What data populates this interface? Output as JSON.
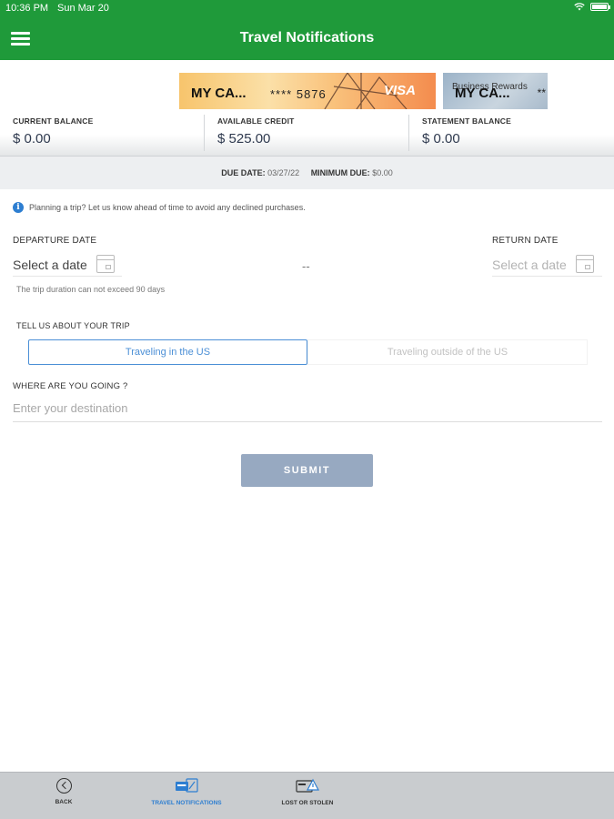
{
  "status_bar": {
    "time": "10:36 PM",
    "date": "Sun Mar 20"
  },
  "header": {
    "title": "Travel Notifications",
    "menu_icon": "hamburger-menu-icon"
  },
  "cards": {
    "primary": {
      "name": "MY CA...",
      "number": "**** 5876",
      "brand": "VISA"
    },
    "secondary": {
      "subtitle": "Business Rewards",
      "name": "MY CA...",
      "number_suffix": "**"
    }
  },
  "balances": {
    "current": {
      "label": "CURRENT BALANCE",
      "value": "$ 0.00"
    },
    "available": {
      "label": "AVAILABLE CREDIT",
      "value": "$ 525.00"
    },
    "statement": {
      "label": "STATEMENT BALANCE",
      "value": "$ 0.00"
    }
  },
  "due": {
    "due_label": "DUE DATE:",
    "due_value": "03/27/22",
    "min_label": "MINIMUM DUE:",
    "min_value": "$0.00"
  },
  "info": {
    "icon": "info-icon",
    "text": "Planning a trip? Let us know ahead of time to avoid any declined purchases."
  },
  "departure": {
    "label": "DEPARTURE DATE",
    "placeholder": "Select a date"
  },
  "return": {
    "label": "RETURN DATE",
    "placeholder": "Select a date"
  },
  "date_separator": "--",
  "duration_hint": "The trip duration can not exceed 90 days",
  "trip_type": {
    "label": "TELL US ABOUT YOUR TRIP",
    "options": [
      "Traveling in the US",
      "Traveling outside of the US"
    ],
    "selected": "Traveling in the US"
  },
  "destination": {
    "label": "WHERE ARE YOU GOING ?",
    "placeholder": "Enter your destination"
  },
  "submit_label": "SUBMIT",
  "bottom_nav": [
    {
      "label": "BACK",
      "icon": "back-icon"
    },
    {
      "label": "TRAVEL NOTIFICATIONS",
      "icon": "travel-notifications-icon",
      "active": true
    },
    {
      "label": "LOST OR STOLEN",
      "icon": "lost-or-stolen-icon"
    }
  ],
  "colors": {
    "header_green": "#1f9a3a",
    "accent_blue": "#4b8fd6",
    "submit_disabled": "#97a9c1"
  }
}
